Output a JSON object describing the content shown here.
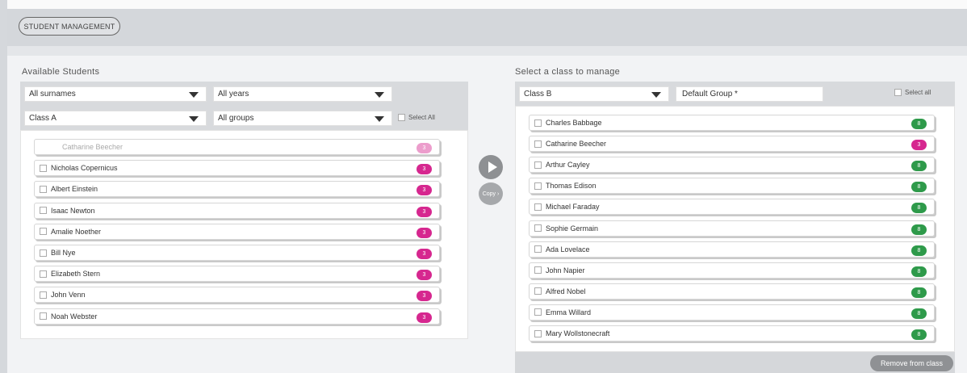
{
  "header": {
    "student_management_label": "STUDENT MANAGEMENT"
  },
  "left_panel": {
    "title": "Available Students",
    "filters": {
      "surname": "All surnames",
      "years": "All years",
      "class": "Class A",
      "groups": "All groups",
      "select_all": "Select All"
    },
    "students": [
      {
        "name": "Catharine Beecher",
        "badge": "3",
        "disabled": true
      },
      {
        "name": "Nicholas Copernicus",
        "badge": "3"
      },
      {
        "name": "Albert Einstein",
        "badge": "3"
      },
      {
        "name": "Isaac Newton",
        "badge": "3"
      },
      {
        "name": "Amalie Noether",
        "badge": "3"
      },
      {
        "name": "Bill Nye",
        "badge": "3"
      },
      {
        "name": "Elizabeth Stern",
        "badge": "3"
      },
      {
        "name": "John Venn",
        "badge": "3"
      },
      {
        "name": "Noah Webster",
        "badge": "3"
      }
    ]
  },
  "transfer": {
    "copy_label": "Copy ›"
  },
  "right_panel": {
    "title": "Select a class to manage",
    "class_select": "Class B",
    "group_field": "Default Group *",
    "select_all": "Select all",
    "students": [
      {
        "name": "Charles Babbage",
        "badge": "8",
        "color": "green"
      },
      {
        "name": "Catharine Beecher",
        "badge": "3",
        "color": "pink"
      },
      {
        "name": "Arthur Cayley",
        "badge": "8",
        "color": "green"
      },
      {
        "name": "Thomas Edison",
        "badge": "8",
        "color": "green"
      },
      {
        "name": "Michael Faraday",
        "badge": "8",
        "color": "green"
      },
      {
        "name": "Sophie Germain",
        "badge": "8",
        "color": "green"
      },
      {
        "name": "Ada Lovelace",
        "badge": "8",
        "color": "green"
      },
      {
        "name": "John Napier",
        "badge": "8",
        "color": "green"
      },
      {
        "name": "Alfred Nobel",
        "badge": "8",
        "color": "green"
      },
      {
        "name": "Emma Willard",
        "badge": "8",
        "color": "green"
      },
      {
        "name": "Mary Wollstonecraft",
        "badge": "8",
        "color": "green"
      }
    ],
    "remove_label": "Remove from class"
  },
  "colors": {
    "pink": "#d6278f",
    "green": "#2e9a4a",
    "accent_gray": "#8e9093"
  },
  "icons": {
    "play": "play-icon",
    "checkbox": "checkbox-icon",
    "dropdown": "chevron-down-icon"
  }
}
